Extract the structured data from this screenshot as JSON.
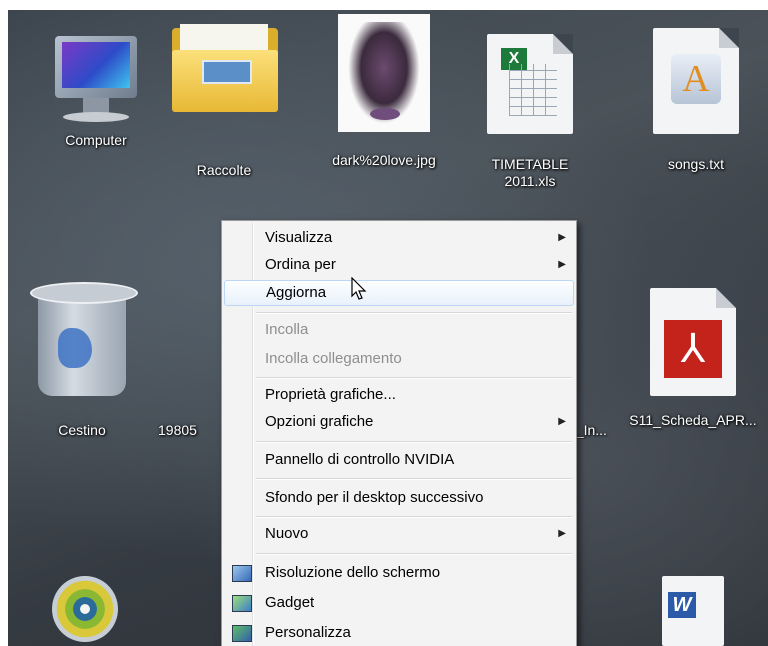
{
  "desktop": {
    "icons": [
      {
        "label": "Computer"
      },
      {
        "label": "Raccolte"
      },
      {
        "label": "dark%20love.jpg"
      },
      {
        "label": "TIMETABLE\n2011.xls"
      },
      {
        "label": "songs.txt"
      },
      {
        "label": "Cestino"
      },
      {
        "label": "19805"
      },
      {
        "label": "S11_Scheda_APR..."
      },
      {
        "label": "4_In..."
      }
    ]
  },
  "context_menu": {
    "items": [
      {
        "label": "Visualizza",
        "submenu": true,
        "enabled": true
      },
      {
        "label": "Ordina per",
        "submenu": true,
        "enabled": true
      },
      {
        "label": "Aggiorna",
        "submenu": false,
        "enabled": true,
        "hovered": true
      },
      {
        "label": "Incolla",
        "submenu": false,
        "enabled": false
      },
      {
        "label": "Incolla collegamento",
        "submenu": false,
        "enabled": false
      },
      {
        "label": "Proprietà grafiche...",
        "submenu": false,
        "enabled": true
      },
      {
        "label": "Opzioni grafiche",
        "submenu": true,
        "enabled": true
      },
      {
        "label": "Pannello di controllo NVIDIA",
        "submenu": false,
        "enabled": true
      },
      {
        "label": "Sfondo per il desktop successivo",
        "submenu": false,
        "enabled": true
      },
      {
        "label": "Nuovo",
        "submenu": true,
        "enabled": true
      },
      {
        "label": "Risoluzione dello schermo",
        "submenu": false,
        "enabled": true,
        "icon": "display-icon"
      },
      {
        "label": "Gadget",
        "submenu": false,
        "enabled": true,
        "icon": "gadget-icon"
      },
      {
        "label": "Personalizza",
        "submenu": false,
        "enabled": true,
        "icon": "personalize-icon"
      }
    ],
    "submenu_glyph": "▶"
  }
}
